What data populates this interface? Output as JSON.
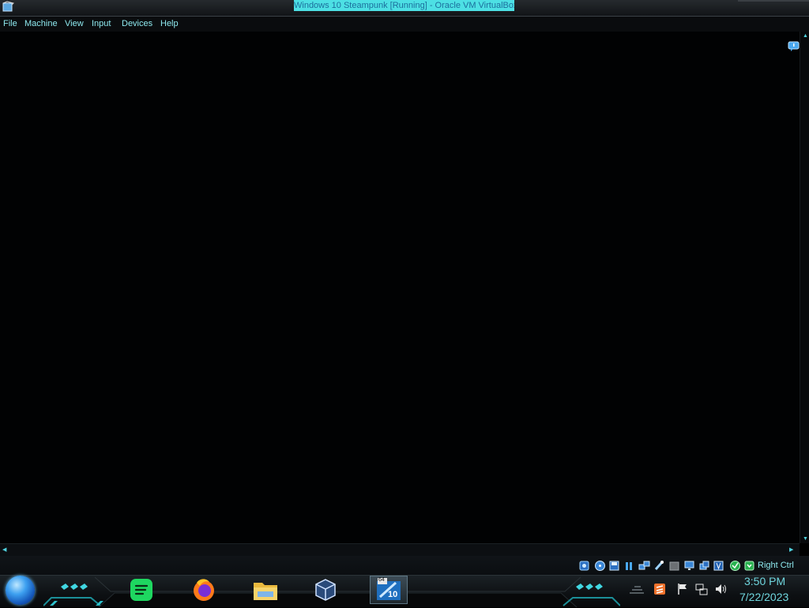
{
  "window": {
    "title": "Windows 10 Steampunk [Running] - Oracle VM VirtualBox"
  },
  "menu": {
    "file": "File",
    "machine": "Machine",
    "view": "View",
    "input": "Input",
    "devices": "Devices",
    "help": "Help"
  },
  "status_bar": {
    "host_key": "Right Ctrl",
    "icons": [
      "hard-disk-icon",
      "optical-drive-icon",
      "floppy-icon",
      "audio-icon",
      "network-icon",
      "usb-icon",
      "shared-folder-icon",
      "display-icon",
      "video-capture-icon",
      "guest-additions-icon",
      "cpu-activity-icon",
      "mouse-integration-icon",
      "keyboard-icon"
    ]
  },
  "taskbar": {
    "pinned": [
      "start-orb",
      "spotify-icon",
      "firefox-icon",
      "file-explorer-icon",
      "virtualbox-icon",
      "windows-10-vm-icon"
    ],
    "vm_badge": "10",
    "vm_arch": "64",
    "tray": [
      "sublime-text-icon",
      "action-center-flag-icon",
      "network-tray-icon",
      "volume-icon"
    ],
    "clock": {
      "time": "3:50 PM",
      "date": "7/22/2023"
    }
  },
  "colors": {
    "accent": "#4de0e4",
    "text": "#8ee9ef",
    "background": "#000000"
  }
}
